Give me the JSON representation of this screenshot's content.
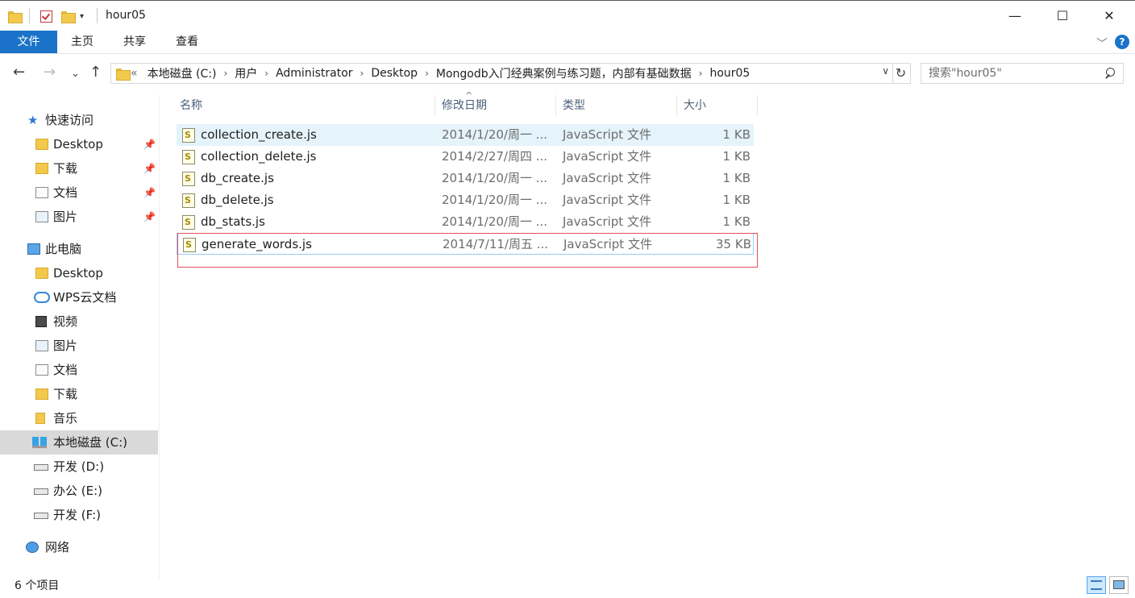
{
  "window": {
    "title": "hour05",
    "minimize_glyph": "—",
    "maximize_glyph": "☐",
    "close_glyph": "✕"
  },
  "quick_access_toolbar": {
    "icons": [
      "folder-icon",
      "properties-checkbox-icon",
      "new-folder-icon",
      "customize-dropdown-icon"
    ]
  },
  "ribbon": {
    "tabs": [
      "文件",
      "主页",
      "共享",
      "查看"
    ],
    "expand_glyph": "﹀",
    "help_glyph": "?"
  },
  "address": {
    "back_glyph": "←",
    "forward_glyph": "→",
    "recent_glyph": "⌄",
    "up_glyph": "↑",
    "overflow": "«",
    "crumbs": [
      "本地磁盘 (C:)",
      "用户",
      "Administrator",
      "Desktop",
      "Mongodb入门经典案例与练习题，内部有基础数据",
      "hour05"
    ],
    "separator": "›",
    "dropdown_glyph": "∨",
    "refresh_glyph": "↻"
  },
  "search": {
    "placeholder": "搜索\"hour05\""
  },
  "nav": {
    "quick_access": "快速访问",
    "qa_items": [
      {
        "label": "Desktop",
        "pinned": true
      },
      {
        "label": "下载",
        "pinned": true
      },
      {
        "label": "文档",
        "pinned": true
      },
      {
        "label": "图片",
        "pinned": true
      }
    ],
    "this_pc": "此电脑",
    "pc_items": [
      "Desktop",
      "WPS云文档",
      "视频",
      "图片",
      "文档",
      "下载",
      "音乐",
      "本地磁盘 (C:)",
      "开发 (D:)",
      "办公 (E:)",
      "开发 (F:)"
    ],
    "network": "网络",
    "pin_glyph": "📌"
  },
  "columns": {
    "name": "名称",
    "date": "修改日期",
    "type": "类型",
    "size": "大小",
    "sort_glyph": "^"
  },
  "files": [
    {
      "name": "collection_create.js",
      "date": "2014/1/20/周一 ...",
      "type": "JavaScript 文件",
      "size": "1 KB"
    },
    {
      "name": "collection_delete.js",
      "date": "2014/2/27/周四 ...",
      "type": "JavaScript 文件",
      "size": "1 KB"
    },
    {
      "name": "db_create.js",
      "date": "2014/1/20/周一 ...",
      "type": "JavaScript 文件",
      "size": "1 KB"
    },
    {
      "name": "db_delete.js",
      "date": "2014/1/20/周一 ...",
      "type": "JavaScript 文件",
      "size": "1 KB"
    },
    {
      "name": "db_stats.js",
      "date": "2014/1/20/周一 ...",
      "type": "JavaScript 文件",
      "size": "1 KB"
    },
    {
      "name": "generate_words.js",
      "date": "2014/7/11/周五 ...",
      "type": "JavaScript 文件",
      "size": "35 KB"
    }
  ],
  "status": {
    "item_count": "6 个项目"
  },
  "colors": {
    "accent": "#1a73c9",
    "hover_row": "#e5f3fb",
    "highlight_box": "#e05060",
    "selected_nav": "#d9d9d9"
  }
}
